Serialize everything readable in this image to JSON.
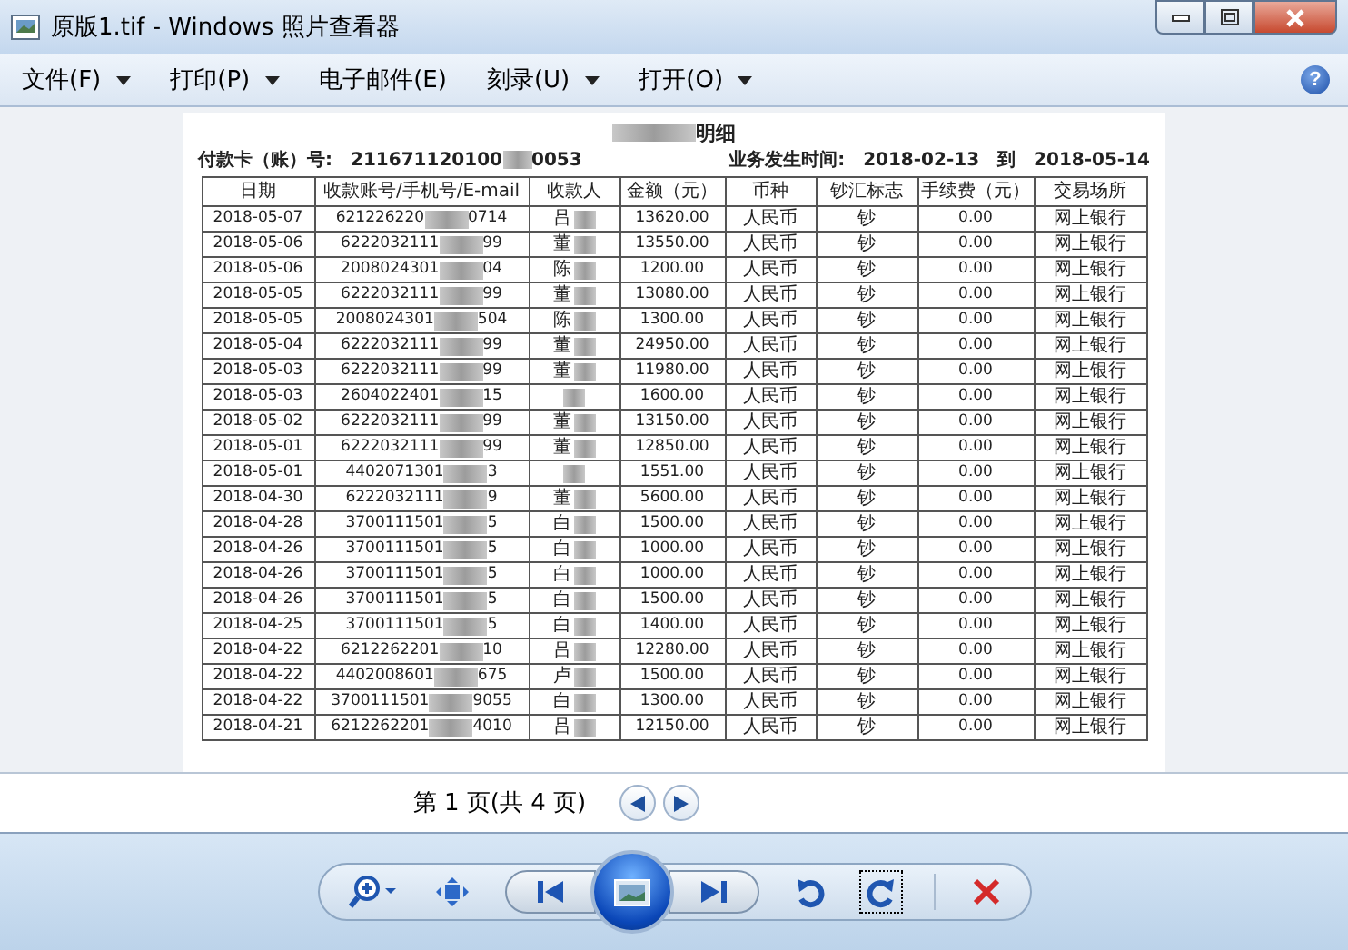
{
  "window": {
    "title": "原版1.tif - Windows 照片查看器"
  },
  "menu": [
    {
      "label": "文件(F)",
      "dropdown": true
    },
    {
      "label": "打印(P)",
      "dropdown": true
    },
    {
      "label": "电子邮件(E)",
      "dropdown": false
    },
    {
      "label": "刻录(U)",
      "dropdown": true
    },
    {
      "label": "打开(O)",
      "dropdown": true
    }
  ],
  "help": "?",
  "document": {
    "title": "明细",
    "card_label": "付款卡（账）号:",
    "card_start": "211671120100",
    "card_end": "0053",
    "period_label": "业务发生时间:",
    "period_from": "2018-02-13",
    "period_to_word": "到",
    "period_to": "2018-05-14",
    "columns": [
      "日期",
      "收款账号/手机号/E-mail",
      "收款人",
      "金额（元）",
      "币种",
      "钞汇标志",
      "手续费（元）",
      "交易场所"
    ],
    "rows": [
      {
        "date": "2018-05-07",
        "account_start": "621226220",
        "account_end": "0714",
        "payee": "吕",
        "amount": "13620.00",
        "currency": "人民币",
        "flag": "钞",
        "fee": "0.00",
        "place": "网上银行"
      },
      {
        "date": "2018-05-06",
        "account_start": "6222032111",
        "account_end": "99",
        "payee": "董",
        "amount": "13550.00",
        "currency": "人民币",
        "flag": "钞",
        "fee": "0.00",
        "place": "网上银行"
      },
      {
        "date": "2018-05-06",
        "account_start": "2008024301",
        "account_end": "04",
        "payee": "陈",
        "amount": "1200.00",
        "currency": "人民币",
        "flag": "钞",
        "fee": "0.00",
        "place": "网上银行"
      },
      {
        "date": "2018-05-05",
        "account_start": "6222032111",
        "account_end": "99",
        "payee": "董",
        "amount": "13080.00",
        "currency": "人民币",
        "flag": "钞",
        "fee": "0.00",
        "place": "网上银行"
      },
      {
        "date": "2018-05-05",
        "account_start": "2008024301",
        "account_end": "504",
        "payee": "陈",
        "amount": "1300.00",
        "currency": "人民币",
        "flag": "钞",
        "fee": "0.00",
        "place": "网上银行"
      },
      {
        "date": "2018-05-04",
        "account_start": "6222032111",
        "account_end": "99",
        "payee": "董",
        "amount": "24950.00",
        "currency": "人民币",
        "flag": "钞",
        "fee": "0.00",
        "place": "网上银行"
      },
      {
        "date": "2018-05-03",
        "account_start": "6222032111",
        "account_end": "99",
        "payee": "董",
        "amount": "11980.00",
        "currency": "人民币",
        "flag": "钞",
        "fee": "0.00",
        "place": "网上银行"
      },
      {
        "date": "2018-05-03",
        "account_start": "2604022401",
        "account_end": "15",
        "payee": "",
        "amount": "1600.00",
        "currency": "人民币",
        "flag": "钞",
        "fee": "0.00",
        "place": "网上银行"
      },
      {
        "date": "2018-05-02",
        "account_start": "6222032111",
        "account_end": "99",
        "payee": "董",
        "amount": "13150.00",
        "currency": "人民币",
        "flag": "钞",
        "fee": "0.00",
        "place": "网上银行"
      },
      {
        "date": "2018-05-01",
        "account_start": "6222032111",
        "account_end": "99",
        "payee": "董",
        "amount": "12850.00",
        "currency": "人民币",
        "flag": "钞",
        "fee": "0.00",
        "place": "网上银行"
      },
      {
        "date": "2018-05-01",
        "account_start": "4402071301",
        "account_end": "3",
        "payee": "",
        "amount": "1551.00",
        "currency": "人民币",
        "flag": "钞",
        "fee": "0.00",
        "place": "网上银行"
      },
      {
        "date": "2018-04-30",
        "account_start": "6222032111",
        "account_end": "9",
        "payee": "董",
        "amount": "5600.00",
        "currency": "人民币",
        "flag": "钞",
        "fee": "0.00",
        "place": "网上银行"
      },
      {
        "date": "2018-04-28",
        "account_start": "3700111501",
        "account_end": "5",
        "payee": "白",
        "amount": "1500.00",
        "currency": "人民币",
        "flag": "钞",
        "fee": "0.00",
        "place": "网上银行"
      },
      {
        "date": "2018-04-26",
        "account_start": "3700111501",
        "account_end": "5",
        "payee": "白",
        "amount": "1000.00",
        "currency": "人民币",
        "flag": "钞",
        "fee": "0.00",
        "place": "网上银行"
      },
      {
        "date": "2018-04-26",
        "account_start": "3700111501",
        "account_end": "5",
        "payee": "白",
        "amount": "1000.00",
        "currency": "人民币",
        "flag": "钞",
        "fee": "0.00",
        "place": "网上银行"
      },
      {
        "date": "2018-04-26",
        "account_start": "3700111501",
        "account_end": "5",
        "payee": "白",
        "amount": "1500.00",
        "currency": "人民币",
        "flag": "钞",
        "fee": "0.00",
        "place": "网上银行"
      },
      {
        "date": "2018-04-25",
        "account_start": "3700111501",
        "account_end": "5",
        "payee": "白",
        "amount": "1400.00",
        "currency": "人民币",
        "flag": "钞",
        "fee": "0.00",
        "place": "网上银行"
      },
      {
        "date": "2018-04-22",
        "account_start": "6212262201",
        "account_end": "10",
        "payee": "吕",
        "amount": "12280.00",
        "currency": "人民币",
        "flag": "钞",
        "fee": "0.00",
        "place": "网上银行"
      },
      {
        "date": "2018-04-22",
        "account_start": "4402008601",
        "account_end": "675",
        "payee": "卢",
        "amount": "1500.00",
        "currency": "人民币",
        "flag": "钞",
        "fee": "0.00",
        "place": "网上银行"
      },
      {
        "date": "2018-04-22",
        "account_start": "3700111501",
        "account_end": "9055",
        "payee": "白",
        "amount": "1300.00",
        "currency": "人民币",
        "flag": "钞",
        "fee": "0.00",
        "place": "网上银行"
      },
      {
        "date": "2018-04-21",
        "account_start": "6212262201",
        "account_end": "4010",
        "payee": "吕",
        "amount": "12150.00",
        "currency": "人民币",
        "flag": "钞",
        "fee": "0.00",
        "place": "网上银行"
      }
    ]
  },
  "pager": {
    "text": "第 1 页(共 4 页)"
  }
}
